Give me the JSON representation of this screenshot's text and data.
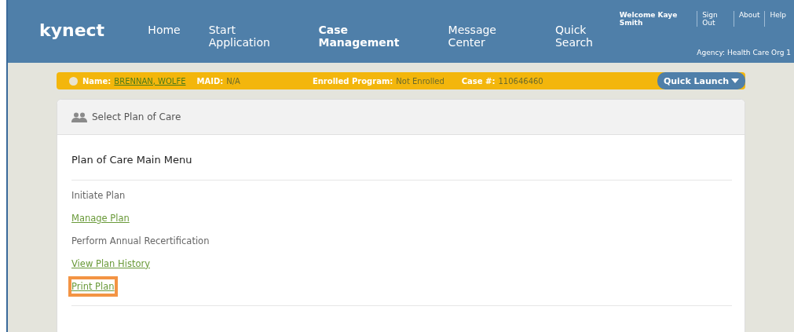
{
  "header": {
    "logo": "kynect",
    "nav": [
      {
        "label": "Home",
        "selected": false
      },
      {
        "label": "Start Application",
        "selected": false
      },
      {
        "label": "Case Management",
        "selected": true
      },
      {
        "label": "Message Center",
        "selected": false
      },
      {
        "label": "Quick Search",
        "selected": false
      }
    ],
    "welcome": "Welcome Kaye Smith",
    "user_links": [
      "Sign Out",
      "About",
      "Help"
    ],
    "agency": "Agency: Health Care Org 1"
  },
  "case_bar": {
    "name_label": "Name:",
    "name": "BRENNAN, WOLFE",
    "maid_label": "MAID:",
    "maid": "N/A",
    "program_label": "Enrolled Program:",
    "program": "Not Enrolled",
    "case_label": "Case #:",
    "case": "110646460",
    "quick_launch": "Quick Launch"
  },
  "panel": {
    "title": "Select Plan of Care",
    "heading": "Plan of Care Main Menu",
    "items": [
      {
        "label": "Initiate Plan",
        "kind": "text",
        "highlighted": false
      },
      {
        "label": "Manage Plan",
        "kind": "link",
        "highlighted": false
      },
      {
        "label": "Perform Annual Recertification",
        "kind": "text",
        "highlighted": false
      },
      {
        "label": "View Plan History",
        "kind": "link",
        "highlighted": false
      },
      {
        "label": "Print Plan",
        "kind": "link",
        "highlighted": true
      }
    ]
  }
}
